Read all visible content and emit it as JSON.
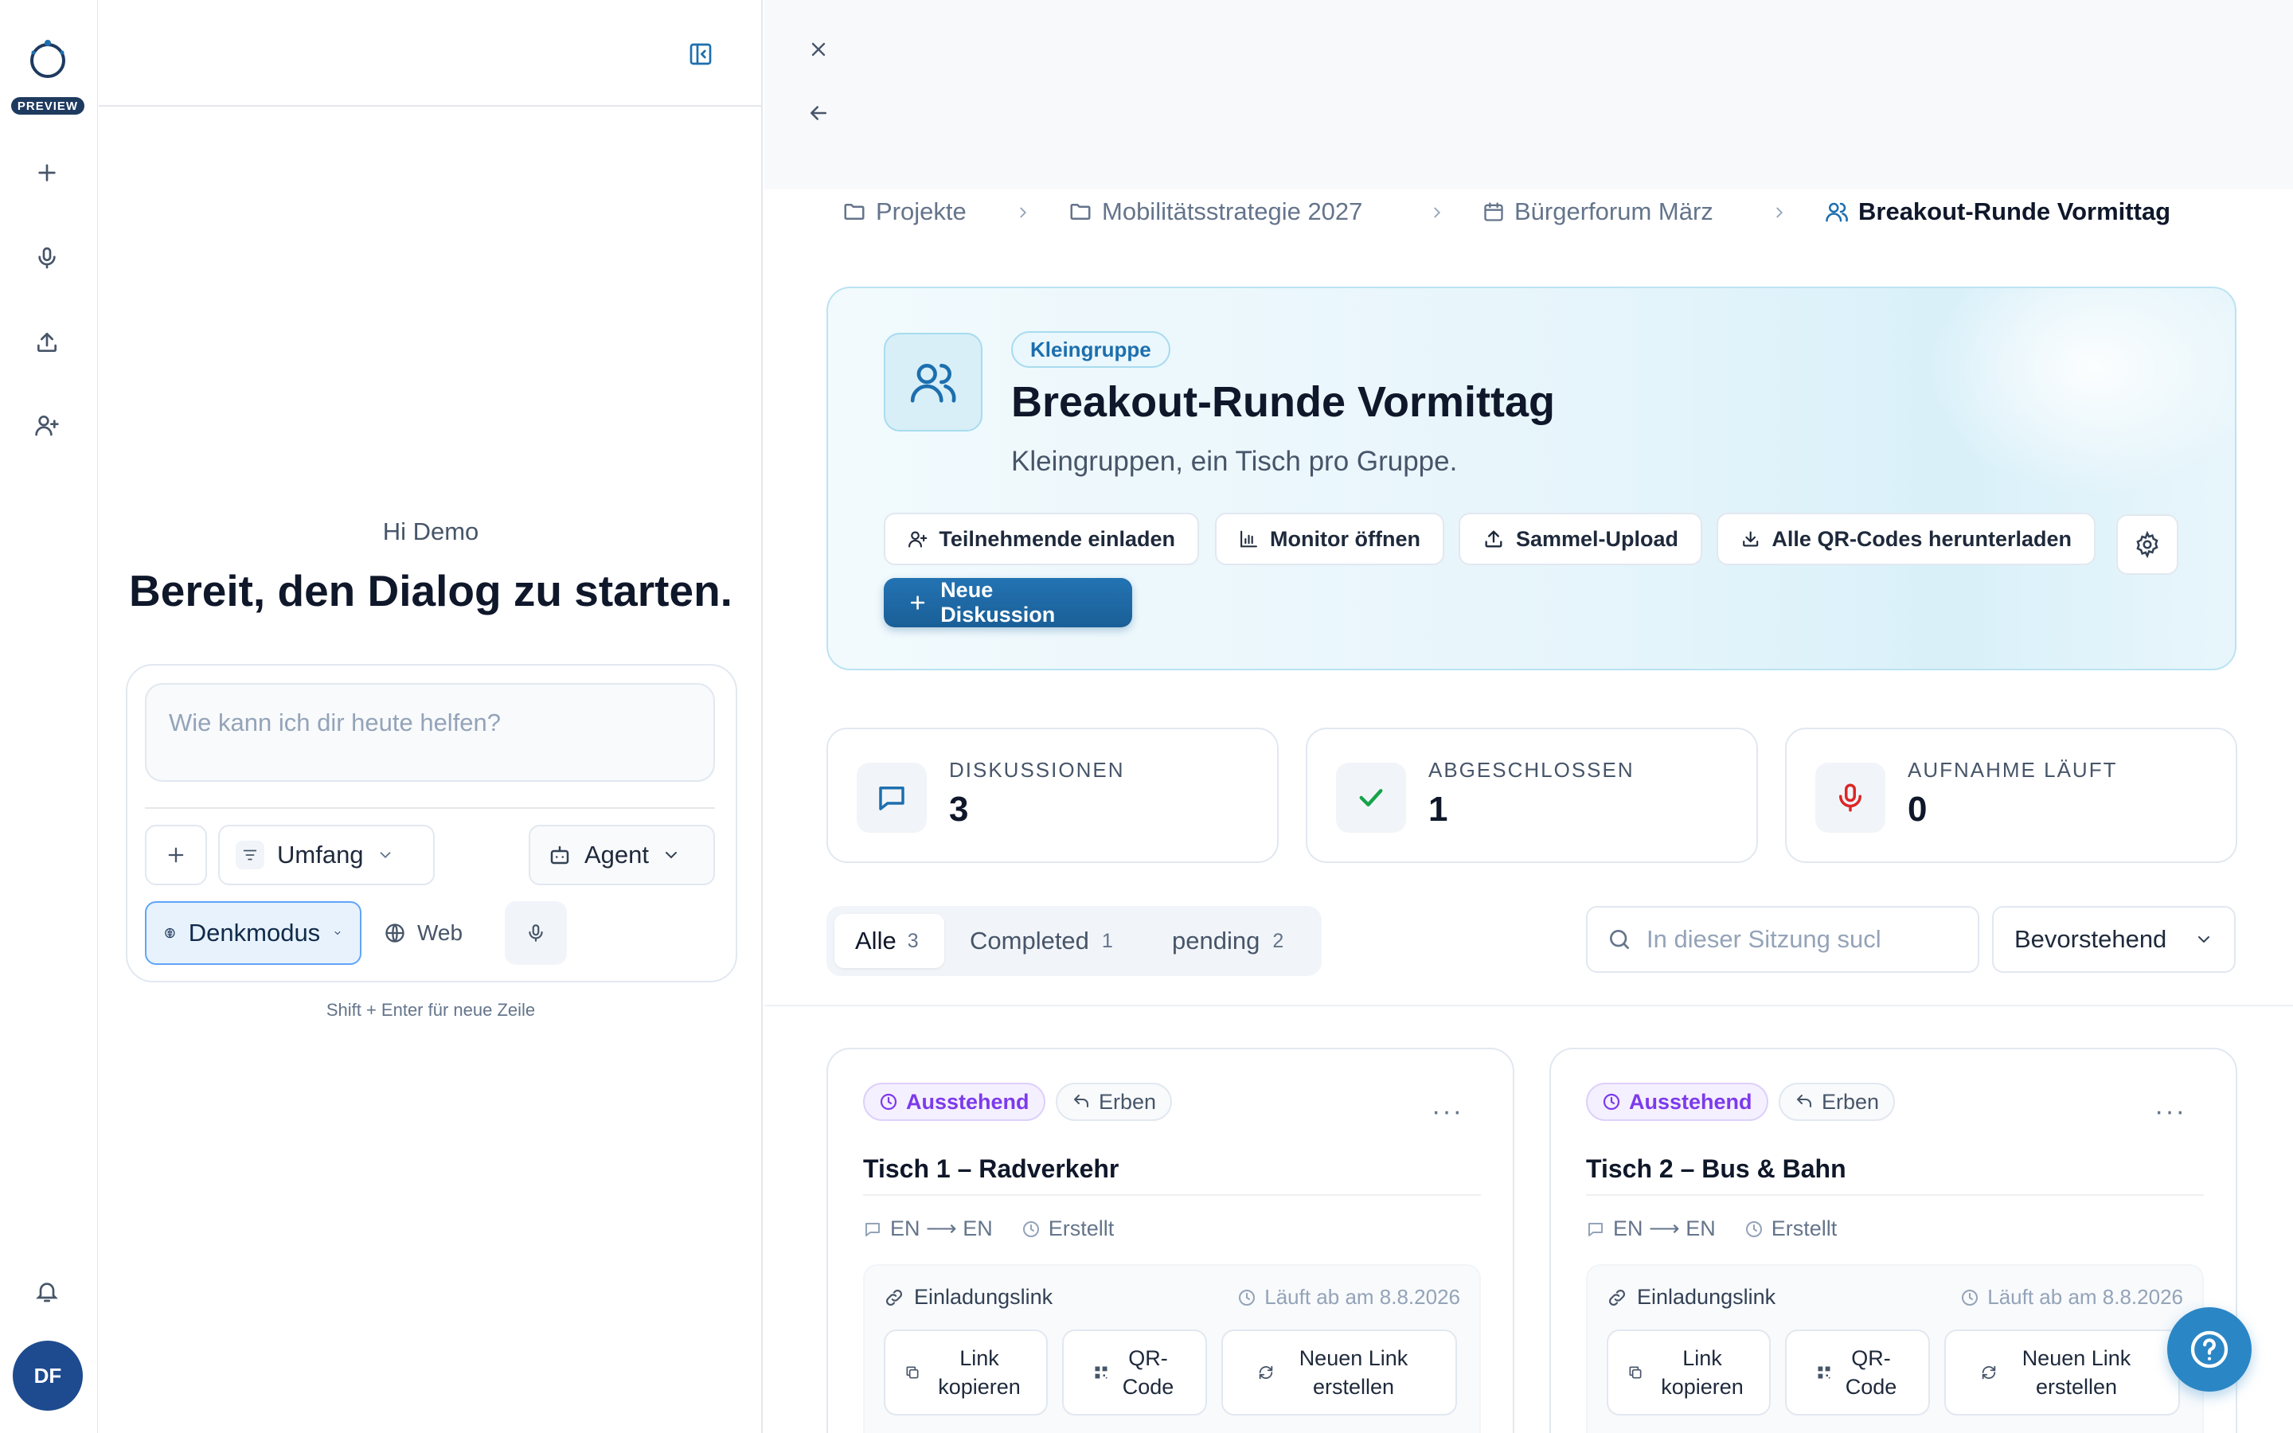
{
  "rail": {
    "preview_badge": "PREVIEW",
    "avatar_initials": "DF",
    "icons": [
      "app-logo-icon",
      "plus-icon",
      "microphone-icon",
      "upload-icon",
      "add-user-icon",
      "bell-icon"
    ]
  },
  "chat": {
    "greeting": "Hi Demo",
    "headline": "Bereit, den Dialog zu starten.",
    "input_placeholder": "Wie kann ich dir heute helfen?",
    "scope_label": "Umfang",
    "agent_label": "Agent",
    "think_mode_label": "Denkmodus",
    "web_label": "Web",
    "hint": "Shift + Enter für neue Zeile"
  },
  "breadcrumb": {
    "items": [
      "Projekte",
      "Mobilitätsstrategie 2027",
      "Bürgerforum März",
      "Breakout-Runde Vormittag"
    ]
  },
  "hero": {
    "tag": "Kleingruppe",
    "title": "Breakout-Runde Vormittag",
    "subtitle": "Kleingruppen, ein Tisch pro Gruppe.",
    "actions": [
      "Teilnehmende einladen",
      "Monitor öffnen",
      "Sammel-Upload",
      "Alle QR-Codes herunterladen"
    ],
    "primary_action": "Neue Diskussion"
  },
  "stats": [
    {
      "label": "DISKUSSIONEN",
      "value": "3",
      "icon": "chat-icon"
    },
    {
      "label": "ABGESCHLOSSEN",
      "value": "1",
      "icon": "check-icon"
    },
    {
      "label": "AUFNAHME LÄUFT",
      "value": "0",
      "icon": "microphone-icon"
    }
  ],
  "filters": {
    "tabs": [
      {
        "label": "Alle",
        "count": "3"
      },
      {
        "label": "Completed",
        "count": "1"
      },
      {
        "label": "pending",
        "count": "2"
      }
    ],
    "search_placeholder": "In dieser Sitzung sucl",
    "sort_label": "Bevorstehend"
  },
  "cards": [
    {
      "status": "Ausstehend",
      "inherit": "Erben",
      "title": "Tisch 1 – Radverkehr",
      "lang": "EN ⟶ EN",
      "created": "Erstellt",
      "link_label": "Einladungslink",
      "expires": "Läuft ab am 8.8.2026",
      "btn_copy": "Link kopieren",
      "btn_qr": "QR-Code",
      "btn_new": "Neuen Link erstellen"
    },
    {
      "status": "Ausstehend",
      "inherit": "Erben",
      "title": "Tisch 2 – Bus & Bahn",
      "lang": "EN ⟶ EN",
      "created": "Erstellt",
      "link_label": "Einladungslink",
      "expires": "Läuft ab am 8.8.2026",
      "btn_copy": "Link kopieren",
      "btn_qr": "QR-Code",
      "btn_new": "Neuen Link erstellen"
    }
  ],
  "colors": {
    "accent": "#1d6fae",
    "status_purple": "#7c3aed",
    "success": "#16a34a",
    "record": "#dc2626"
  }
}
